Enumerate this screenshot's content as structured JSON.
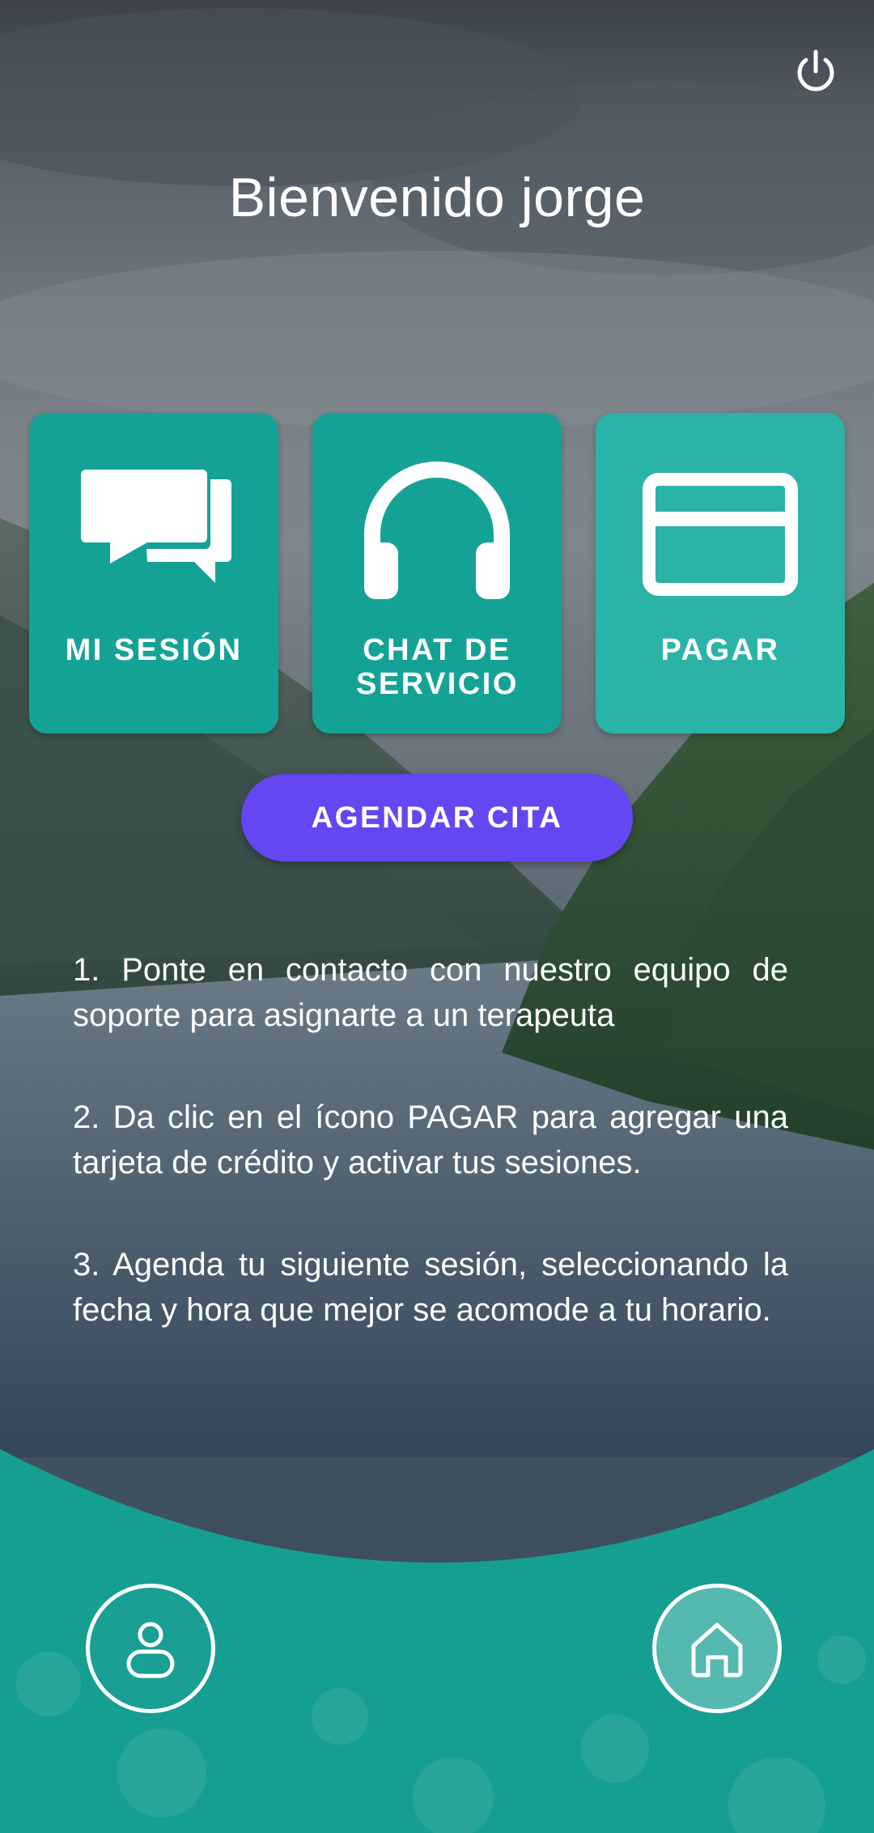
{
  "header": {
    "title": "Bienvenido jorge",
    "power_icon": "power-icon"
  },
  "tiles": [
    {
      "label": "MI SESIÓN",
      "icon": "chat-bubbles-icon",
      "color": "#15a296"
    },
    {
      "label": "CHAT DE SERVICIO",
      "icon": "headphones-icon",
      "color": "#15a296"
    },
    {
      "label": "PAGAR",
      "icon": "credit-card-icon",
      "color": "#2bb3a8"
    }
  ],
  "cta": {
    "label": "AGENDAR CITA",
    "color": "#6446f2"
  },
  "steps": [
    "1. Ponte en contacto con nuestro equipo de soporte para asignarte a un terapeuta",
    "2. Da clic en el ícono PAGAR para agregar una tarjeta de crédito y activar tus sesiones.",
    "3. Agenda tu siguiente sesión, seleccionando la fecha y hora que mejor se acomode a tu horario."
  ],
  "bottom_nav": {
    "profile_icon": "user-icon",
    "home_icon": "home-icon",
    "accent": "#159e92"
  }
}
